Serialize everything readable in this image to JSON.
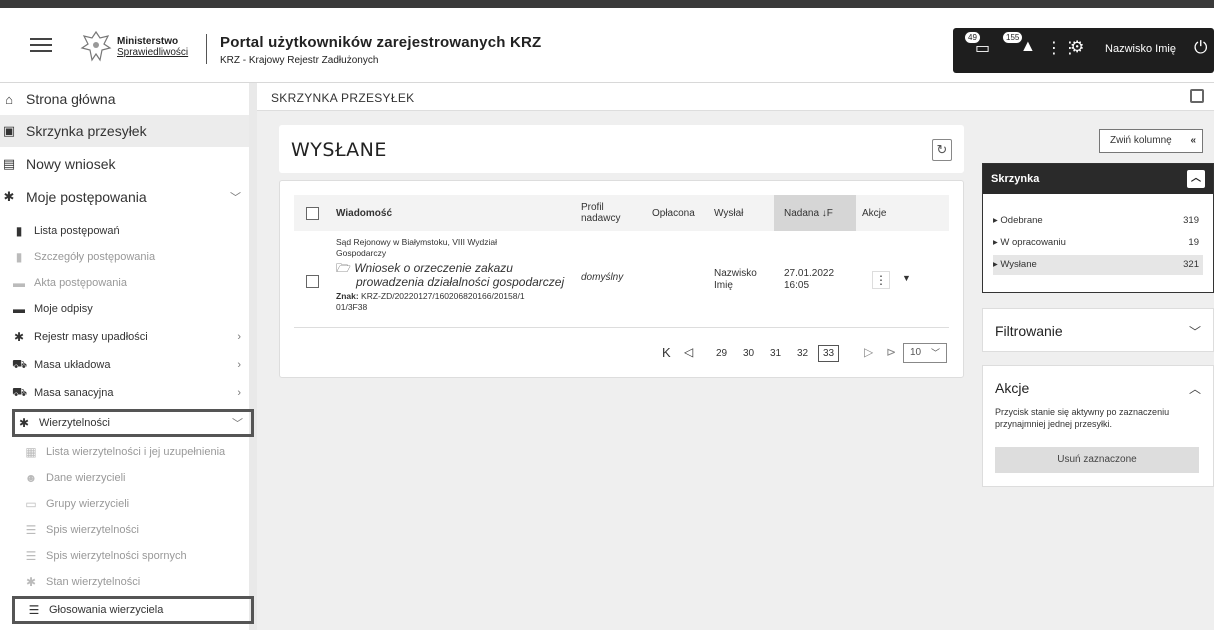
{
  "header": {
    "ministry_line1": "Ministerstwo",
    "ministry_line2": "Sprawiedliwości",
    "portal_title": "Portal użytkowników zarejestrowanych KRZ",
    "portal_subtitle": "KRZ - Krajowy Rejestr Zadłużonych",
    "badge_messages": "49",
    "badge_notifications": "155",
    "user_name": "Nazwisko Imię"
  },
  "sidebar": {
    "main": [
      {
        "label": "Strona główna",
        "icon": "home-icon"
      },
      {
        "label": "Skrzynka przesyłek",
        "icon": "inbox-icon"
      },
      {
        "label": "Nowy wniosek",
        "icon": "document-icon"
      },
      {
        "label": "Moje postępowania",
        "icon": "asterisk-icon"
      }
    ],
    "sub": [
      {
        "label": "Lista postępowań"
      },
      {
        "label": "Szczegóły postępowania"
      },
      {
        "label": "Akta postępowania"
      },
      {
        "label": "Moje odpisy"
      },
      {
        "label": "Rejestr masy upadłości"
      },
      {
        "label": "Masa układowa"
      },
      {
        "label": "Masa sanacyjna"
      },
      {
        "label": "Wierzytelności"
      }
    ],
    "sub2": [
      {
        "label": "Lista wierzytelności i jej uzupełnienia"
      },
      {
        "label": "Dane wierzycieli"
      },
      {
        "label": "Grupy wierzycieli"
      },
      {
        "label": "Spis wierzytelności"
      },
      {
        "label": "Spis wierzytelności spornych"
      },
      {
        "label": "Stan wierzytelności"
      },
      {
        "label": "Głosowania wierzyciela"
      }
    ]
  },
  "breadcrumb": "SKRZYNKA PRZESYŁEK",
  "main": {
    "title": "WYSŁANE",
    "columns": {
      "message": "Wiadomość",
      "profile_line1": "Profil",
      "profile_line2": "nadawcy",
      "paid": "Opłacona",
      "sent_by": "Wysłał",
      "sent_at": "Nadana ↓F",
      "actions": "Akcje"
    },
    "row": {
      "court_line1": "Sąd Rejonowy w Białymstoku, VIII Wydział",
      "court_line2": "Gospodarczy",
      "subject_line1": "Wniosek o orzeczenie zakazu",
      "subject_line2": "prowadzenia działalności gospodarczej",
      "sign_label": "Znak:",
      "sign_line1": "KRZ-ZD/20220127/160206820166/20158/1",
      "sign_line2": "01/3F38",
      "profile": "domyślny",
      "sent_by_line1": "Nazwisko",
      "sent_by_line2": "Imię",
      "date": "27.01.2022",
      "time": "16:05"
    },
    "pager": {
      "pages": [
        "29",
        "30",
        "31",
        "32"
      ],
      "current": "33",
      "page_size": "10"
    }
  },
  "right": {
    "collapse": "Zwiń kolumnę",
    "inbox_title": "Skrzynka",
    "inbox_items": [
      {
        "label": "Odebrane",
        "count": "319"
      },
      {
        "label": "W opracowaniu",
        "count": "19"
      },
      {
        "label": "Wysłane",
        "count": "321"
      }
    ],
    "filter_title": "Filtrowanie",
    "actions_title": "Akcje",
    "actions_desc": "Przycisk stanie się aktywny po zaznaczeniu przynajmniej jednej przesyłki.",
    "delete_button": "Usuń zaznaczone"
  }
}
